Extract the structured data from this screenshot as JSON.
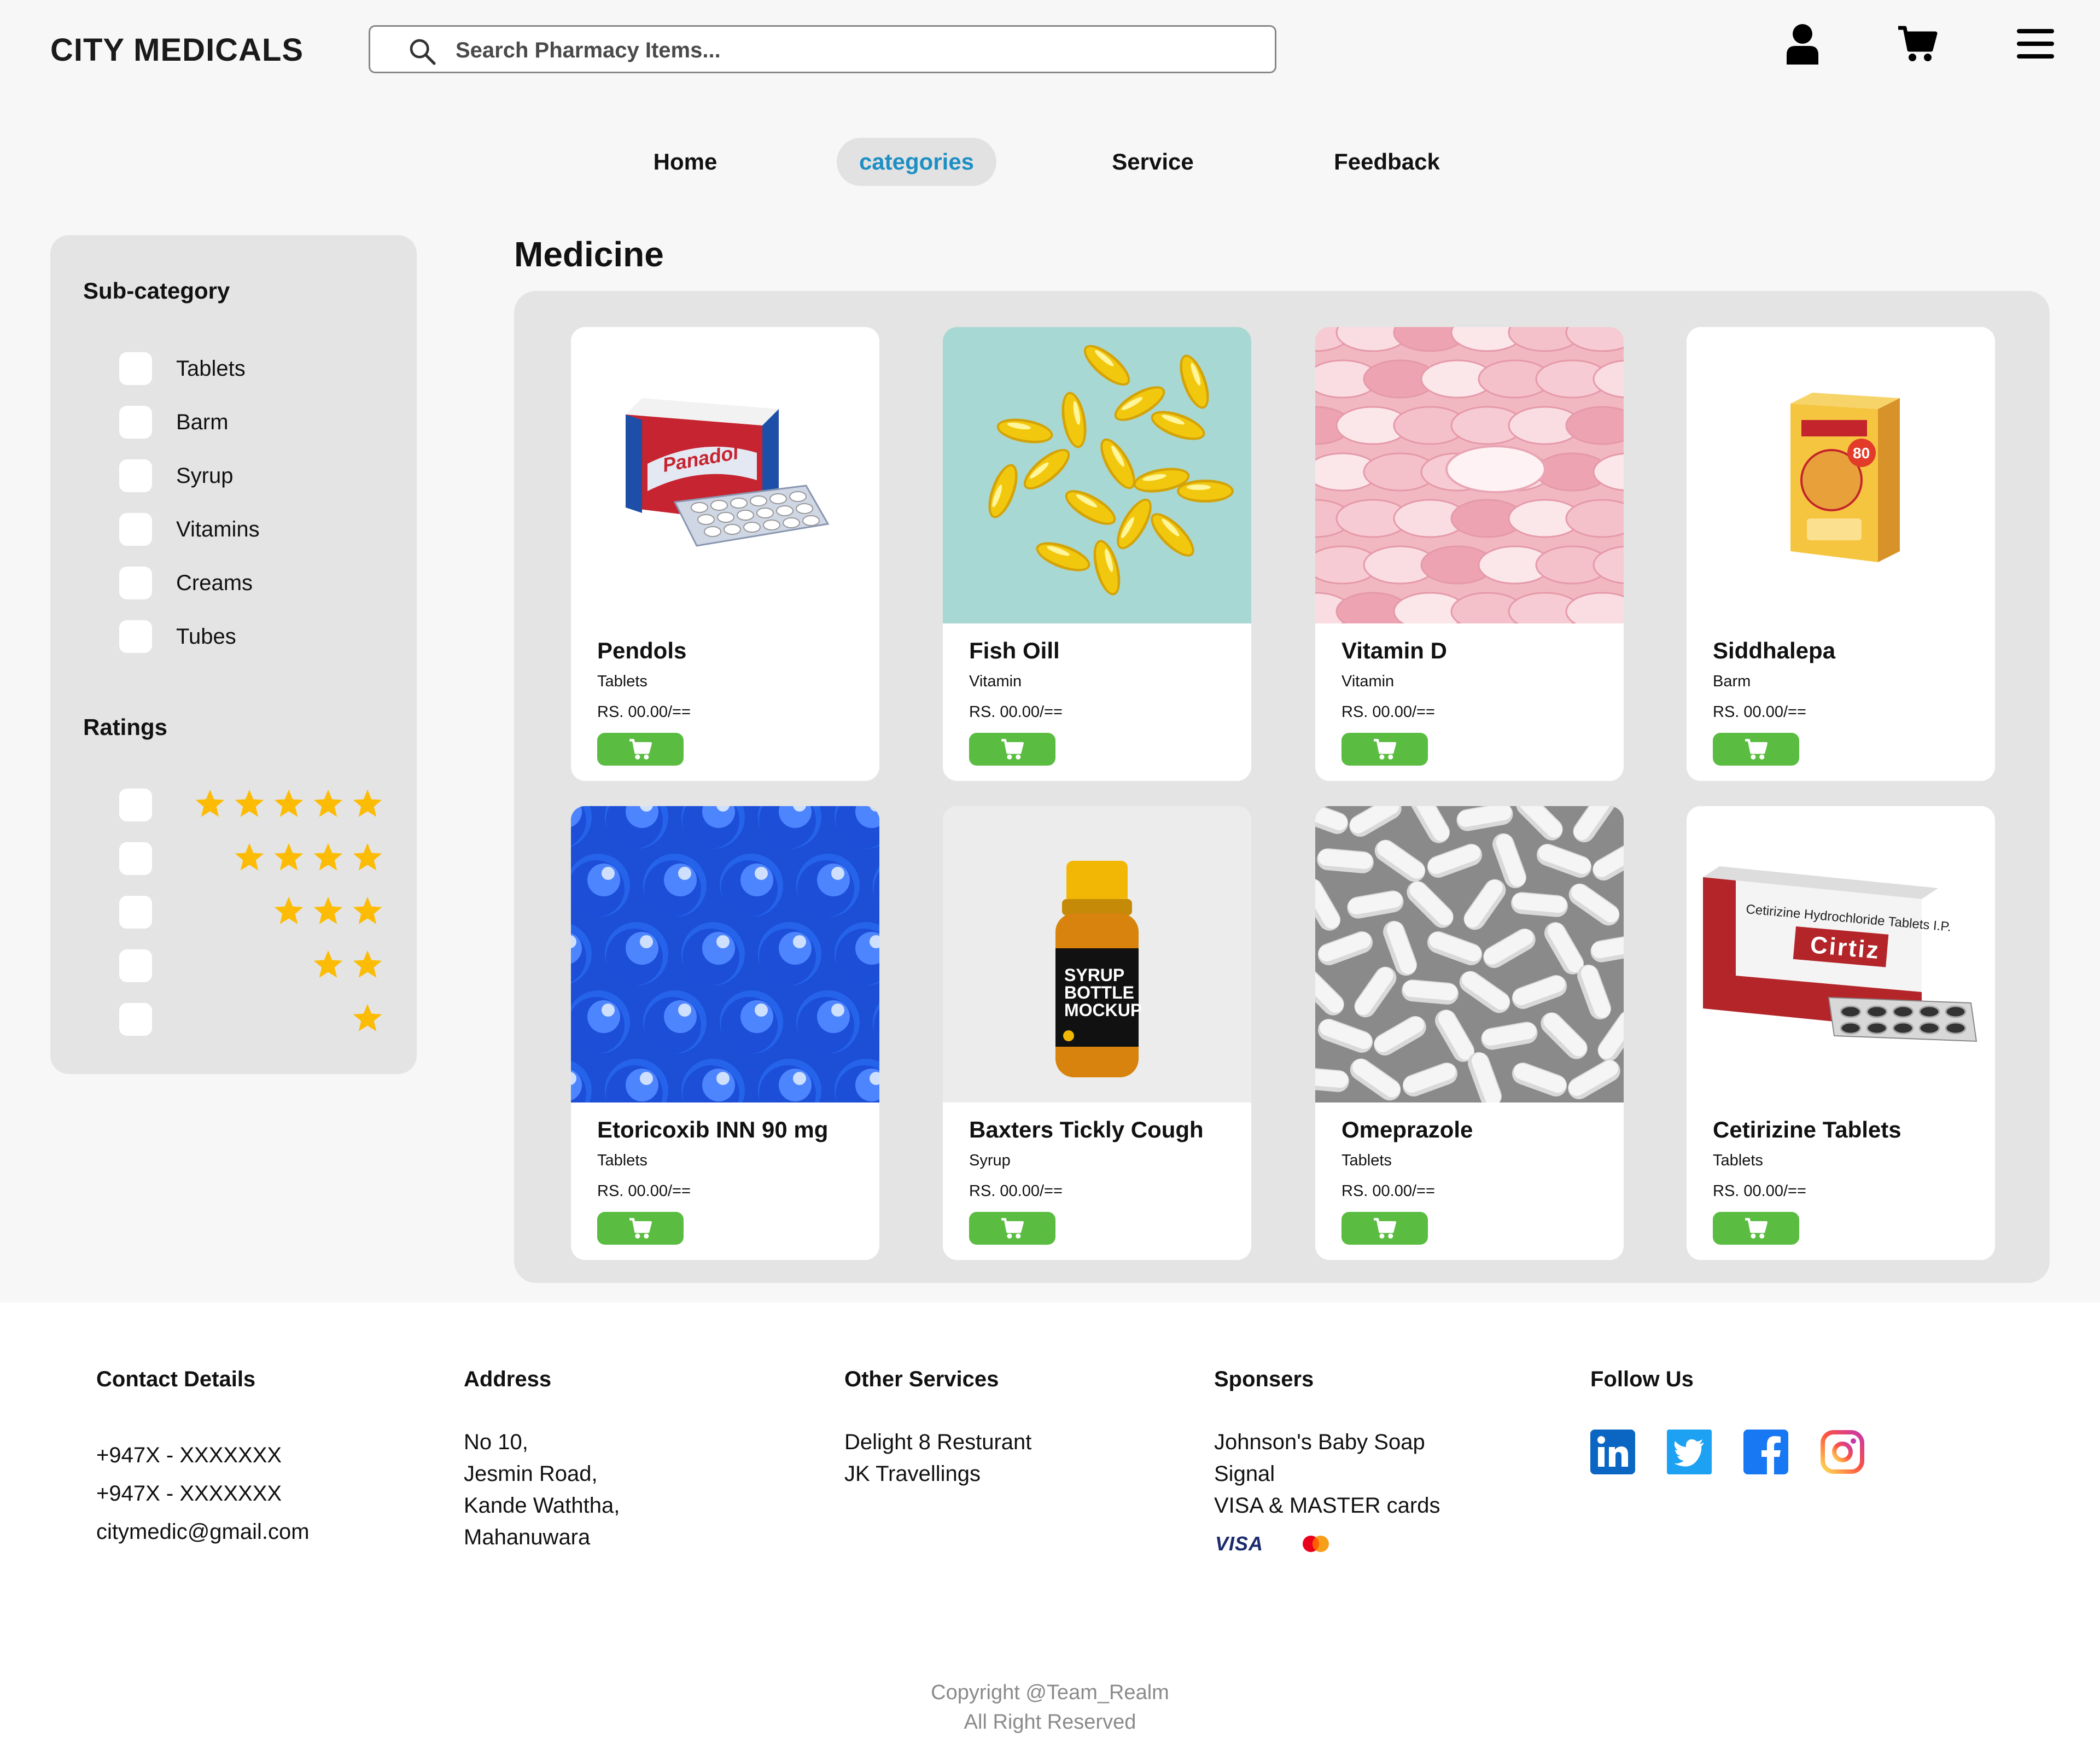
{
  "header": {
    "brand": "CITY MEDICALS",
    "search_placeholder": "Search Pharmacy Items...",
    "icons": [
      "user-icon",
      "cart-icon",
      "menu-icon"
    ]
  },
  "nav": {
    "items": [
      {
        "label": "Home",
        "active": false
      },
      {
        "label": "categories",
        "active": true
      },
      {
        "label": "Service",
        "active": false
      },
      {
        "label": "Feedback",
        "active": false
      }
    ]
  },
  "sidebar": {
    "subcategory_title": "Sub-category",
    "subcategories": [
      "Tablets",
      "Barm",
      "Syrup",
      "Vitamins",
      "Creams",
      "Tubes"
    ],
    "ratings_title": "Ratings",
    "ratings": [
      5,
      4,
      3,
      2,
      1
    ]
  },
  "main": {
    "heading": "Medicine",
    "products": [
      {
        "name": "Pendols",
        "type": "Tablets",
        "price": "RS. 00.00/=="
      },
      {
        "name": "Fish Oill",
        "type": "Vitamin",
        "price": "RS. 00.00/=="
      },
      {
        "name": "Vitamin D",
        "type": "Vitamin",
        "price": "RS. 00.00/=="
      },
      {
        "name": "Siddhalepa",
        "type": "Barm",
        "price": "RS. 00.00/=="
      },
      {
        "name": "Etoricoxib INN 90 mg",
        "type": "Tablets",
        "price": "RS. 00.00/=="
      },
      {
        "name": "Baxters Tickly Cough",
        "type": "Syrup",
        "price": "RS. 00.00/=="
      },
      {
        "name": "Omeprazole",
        "type": "Tablets",
        "price": "RS. 00.00/=="
      },
      {
        "name": "Cetirizine Tablets",
        "type": "Tablets",
        "price": "RS. 00.00/=="
      }
    ],
    "image_text": {
      "panadol": "Panadol",
      "siddhalepa_80": "80",
      "syrup": [
        "SYRUP",
        "BOTTLE",
        "MOCKUP"
      ],
      "cirtiz_header": "Cetirizine Hydrochloride Tablets I.P.",
      "cirtiz_brand": "Cirtiz"
    }
  },
  "footer": {
    "contact": {
      "title": "Contact Details",
      "lines": [
        "+947X - XXXXXXX",
        "+947X - XXXXXXX",
        "citymedic@gmail.com"
      ]
    },
    "address": {
      "title": "Address",
      "lines": [
        "No 10,",
        "Jesmin Road,",
        "Kande Waththa,",
        "Mahanuwara"
      ]
    },
    "services": {
      "title": "Other Services",
      "lines": [
        "Delight 8 Resturant",
        "JK Travellings"
      ]
    },
    "sponsors": {
      "title": "Sponsers",
      "lines": [
        "Johnson's Baby Soap",
        "Signal",
        "VISA & MASTER cards"
      ],
      "visa_logo": "VISA"
    },
    "follow": {
      "title": "Follow Us",
      "icons": [
        "linkedin-icon",
        "twitter-icon",
        "facebook-icon",
        "instagram-icon"
      ]
    },
    "copyright": [
      "Copyright @Team_Realm",
      "All Right Reserved"
    ]
  },
  "colors": {
    "accent": "#1d8fc4",
    "cart_button": "#5bbc42",
    "star": "#fcbc05",
    "panel": "#e4e4e4"
  }
}
